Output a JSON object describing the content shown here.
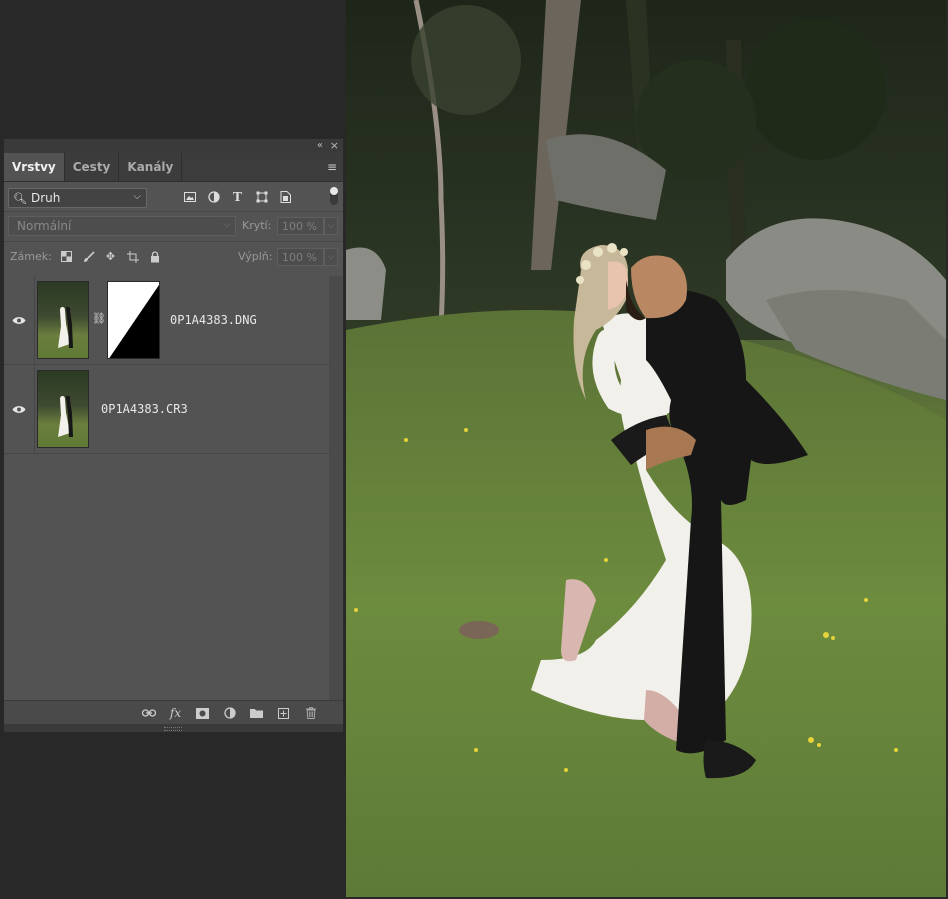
{
  "panel": {
    "topbar": {
      "collapse_glyph": "«",
      "close_glyph": "×"
    },
    "tabs": [
      {
        "label": "Vrstvy",
        "active": true
      },
      {
        "label": "Cesty",
        "active": false
      },
      {
        "label": "Kanály",
        "active": false
      }
    ],
    "filter": {
      "selected": "Druh",
      "icons": [
        "image-filter-icon",
        "adjustment-filter-icon",
        "type-filter-icon",
        "shape-filter-icon",
        "smart-object-filter-icon"
      ]
    },
    "blend": {
      "mode": "Normální",
      "opacity_label": "Krytí:",
      "opacity_value": "100 %"
    },
    "lock": {
      "label": "Zámek:",
      "icons": [
        "lock-transparency-icon",
        "lock-pixels-icon",
        "lock-position-icon",
        "lock-artboard-icon",
        "lock-all-icon"
      ],
      "fill_label": "Výplň:",
      "fill_value": "100 %"
    },
    "layers": [
      {
        "name": "0P1A4383.DNG",
        "visible": true,
        "has_mask": true
      },
      {
        "name": "0P1A4383.CR3",
        "visible": true,
        "has_mask": false
      }
    ],
    "footer_icons": [
      "link-layers-icon",
      "fx-icon",
      "add-mask-icon",
      "adjustment-layer-icon",
      "group-folder-icon",
      "new-layer-icon",
      "trash-icon"
    ]
  },
  "colors": {
    "panel_bg": "#535353",
    "tab_bar_bg": "#3c3c3c",
    "app_bg": "#282828",
    "grass": "#6a8a3c",
    "forest": "#2d3524",
    "dress": "#f2f0ea",
    "suit": "#161616"
  }
}
